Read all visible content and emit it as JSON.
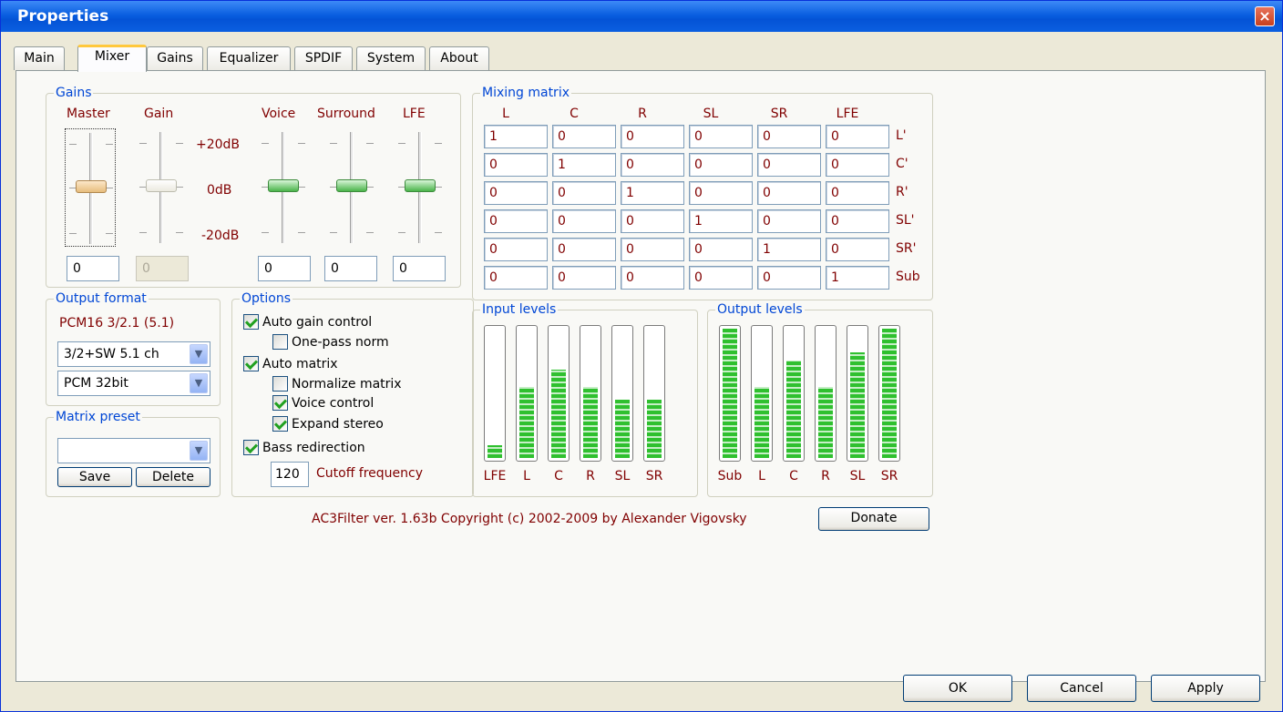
{
  "window": {
    "title": "Properties"
  },
  "tabs": [
    {
      "label": "Main",
      "active": false
    },
    {
      "label": "Mixer",
      "active": true
    },
    {
      "label": "Gains",
      "active": false
    },
    {
      "label": "Equalizer",
      "active": false
    },
    {
      "label": "SPDIF",
      "active": false
    },
    {
      "label": "System",
      "active": false
    },
    {
      "label": "About",
      "active": false
    }
  ],
  "gains": {
    "title": "Gains",
    "labels": {
      "master": "Master",
      "gain": "Gain",
      "voice": "Voice",
      "surround": "Surround",
      "lfe": "LFE"
    },
    "scale": {
      "plus20": "+20dB",
      "zero": "0dB",
      "minus20": "-20dB"
    },
    "values": {
      "master": "0",
      "gain": "0",
      "voice": "0",
      "surround": "0",
      "lfe": "0"
    }
  },
  "mixing_matrix": {
    "title": "Mixing matrix",
    "columns": [
      "L",
      "C",
      "R",
      "SL",
      "SR",
      "LFE"
    ],
    "rows": [
      "L'",
      "C'",
      "R'",
      "SL'",
      "SR'",
      "Sub"
    ],
    "values": [
      [
        "1",
        "0",
        "0",
        "0",
        "0",
        "0"
      ],
      [
        "0",
        "1",
        "0",
        "0",
        "0",
        "0"
      ],
      [
        "0",
        "0",
        "1",
        "0",
        "0",
        "0"
      ],
      [
        "0",
        "0",
        "0",
        "1",
        "0",
        "0"
      ],
      [
        "0",
        "0",
        "0",
        "0",
        "1",
        "0"
      ],
      [
        "0",
        "0",
        "0",
        "0",
        "0",
        "1"
      ]
    ]
  },
  "output_format": {
    "title": "Output format",
    "current": "PCM16 3/2.1 (5.1)",
    "speakers": "3/2+SW 5.1 ch",
    "format": "PCM 32bit"
  },
  "matrix_preset": {
    "title": "Matrix preset",
    "value": "",
    "save": "Save",
    "delete": "Delete"
  },
  "options": {
    "title": "Options",
    "auto_gain": {
      "label": "Auto gain control",
      "checked": true
    },
    "one_pass": {
      "label": "One-pass norm",
      "checked": false
    },
    "auto_matrix": {
      "label": "Auto matrix",
      "checked": true
    },
    "normalize": {
      "label": "Normalize matrix",
      "checked": false
    },
    "voice_control": {
      "label": "Voice control",
      "checked": true
    },
    "expand_stereo": {
      "label": "Expand stereo",
      "checked": true
    },
    "bass_redirection": {
      "label": "Bass redirection",
      "checked": true
    },
    "cutoff_value": "120",
    "cutoff_label": "Cutoff frequency"
  },
  "input_levels": {
    "title": "Input levels",
    "channels": [
      "LFE",
      "L",
      "C",
      "R",
      "SL",
      "SR"
    ],
    "levels": [
      0.1,
      0.55,
      0.68,
      0.55,
      0.45,
      0.45
    ]
  },
  "output_levels": {
    "title": "Output levels",
    "channels": [
      "Sub",
      "L",
      "C",
      "R",
      "SL",
      "SR"
    ],
    "levels": [
      1.0,
      0.55,
      0.75,
      0.55,
      0.82,
      1.0
    ]
  },
  "footer": {
    "copyright": "AC3Filter ver. 1.63b Copyright (c) 2002-2009 by Alexander Vigovsky",
    "donate": "Donate"
  },
  "buttons": {
    "ok": "OK",
    "cancel": "Cancel",
    "apply": "Apply"
  },
  "colors": {
    "label_text": "#800000",
    "group_title": "#0046d5",
    "meter_green": "#2fc02f"
  }
}
